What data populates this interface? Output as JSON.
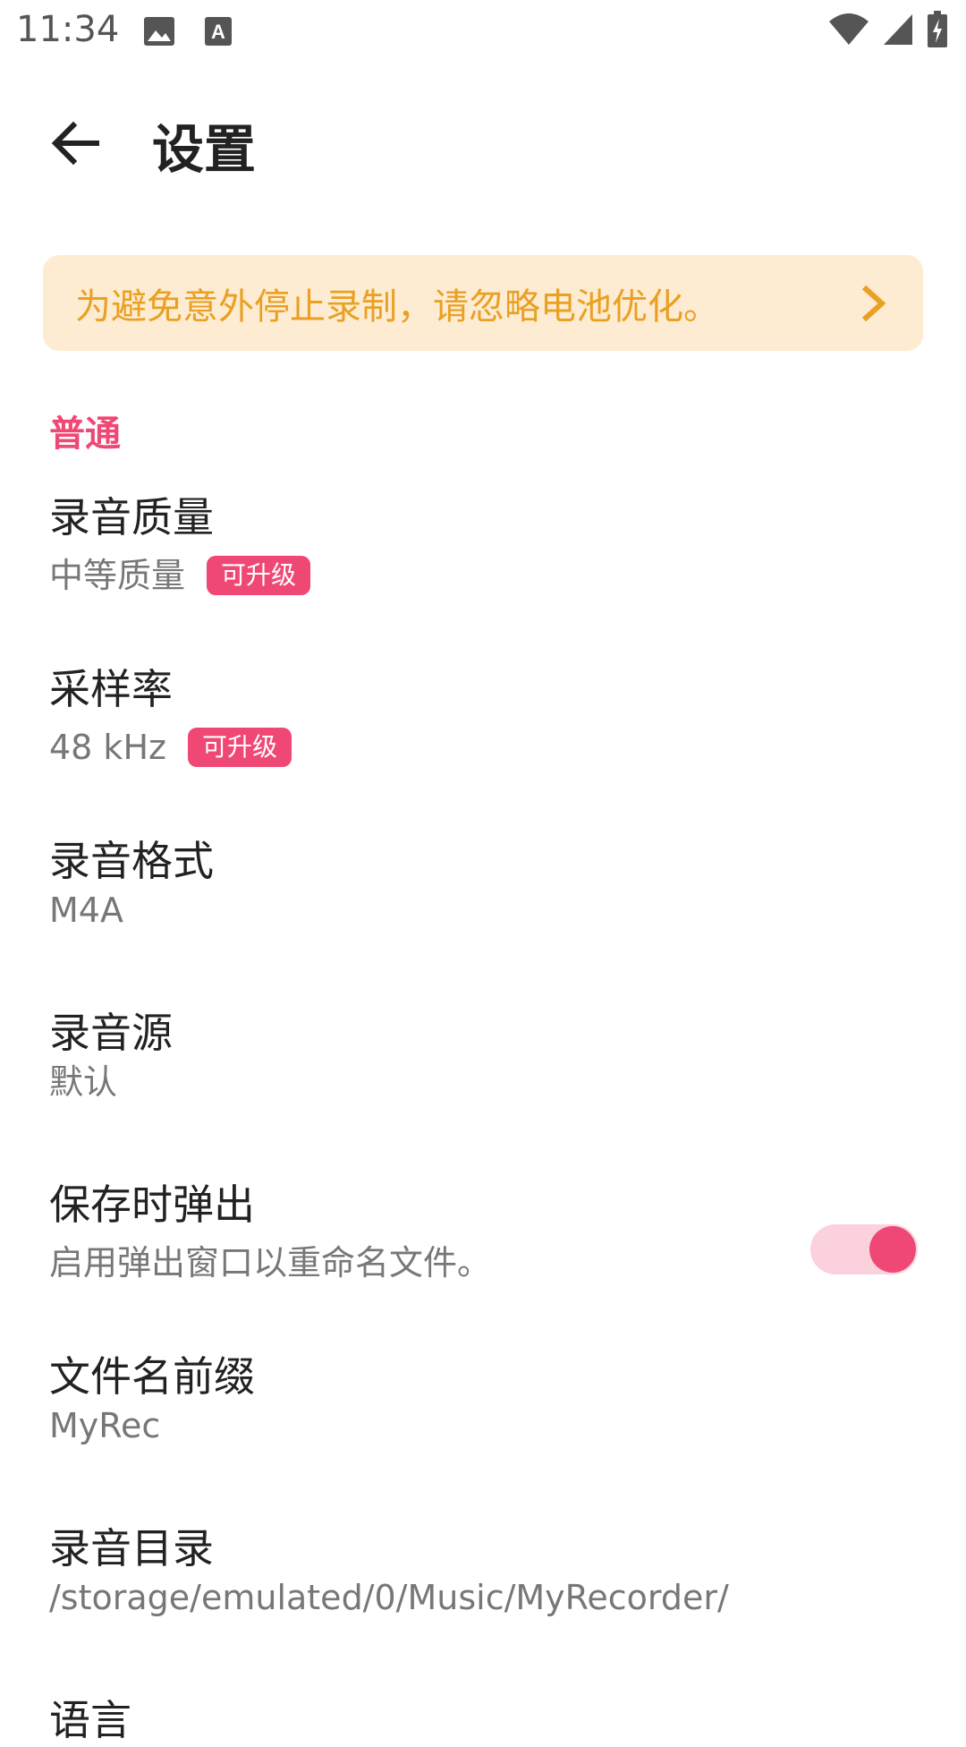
{
  "status_bar": {
    "time": "11:34",
    "icons": [
      "photo-icon",
      "keyboard-a-icon",
      "wifi-icon",
      "signal-icon",
      "battery-charging-icon"
    ]
  },
  "app_bar": {
    "title": "设置",
    "back_icon": "arrow-left-icon"
  },
  "banner": {
    "text": "为避免意外停止录制，请忽略电池优化。",
    "icon": "chevron-right-icon",
    "color": "#e9a023",
    "background": "#fdecd1"
  },
  "section": {
    "title": "普通",
    "color": "#ef4874"
  },
  "settings": [
    {
      "title": "录音质量",
      "subtitle": "中等质量",
      "badge": "可升级"
    },
    {
      "title": "采样率",
      "subtitle": "48 kHz",
      "badge": "可升级"
    },
    {
      "title": "录音格式",
      "subtitle": "M4A"
    },
    {
      "title": "录音源",
      "subtitle": "默认"
    },
    {
      "title": "保存时弹出",
      "subtitle": "启用弹出窗口以重命名文件。",
      "toggle_on": true
    },
    {
      "title": "文件名前缀",
      "subtitle": "MyRec"
    },
    {
      "title": "录音目录",
      "subtitle": "/storage/emulated/0/Music/MyRecorder/"
    },
    {
      "title": "语言"
    }
  ],
  "accent_color": "#ef4874"
}
